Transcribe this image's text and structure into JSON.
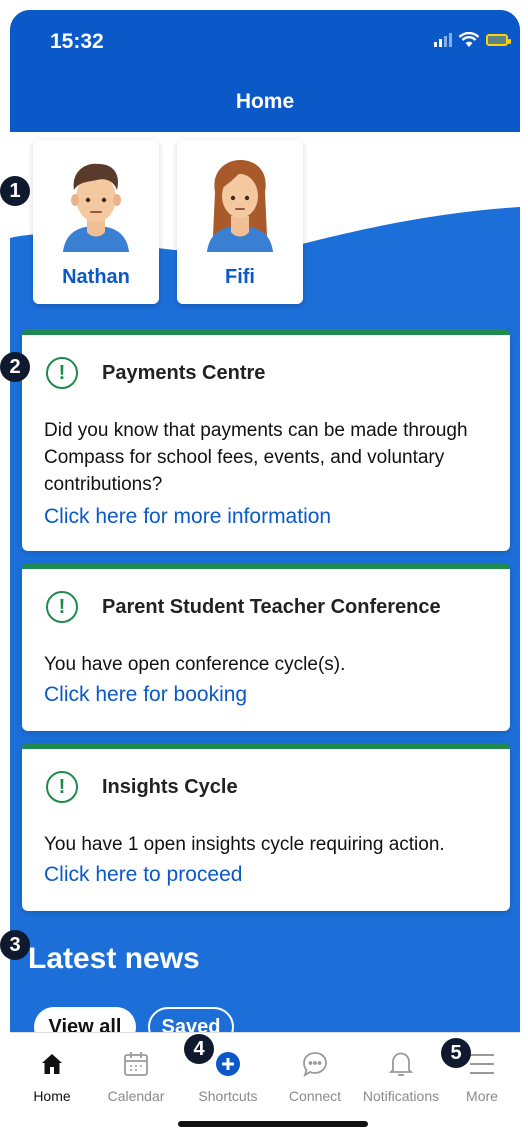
{
  "status_bar": {
    "time": "15:32"
  },
  "header": {
    "title": "Home"
  },
  "students": [
    {
      "name": "Nathan"
    },
    {
      "name": "Fifi"
    }
  ],
  "cards": [
    {
      "title": "Payments Centre",
      "body": "Did you know that payments can be made through Compass for school fees, events, and voluntary contributions?",
      "link": "Click here for more information"
    },
    {
      "title": "Parent Student Teacher Conference",
      "body": "You have open conference cycle(s).",
      "link": "Click here for booking"
    },
    {
      "title": "Insights Cycle",
      "body": "You have 1 open insights cycle requiring action.",
      "link": "Click here to proceed"
    }
  ],
  "news": {
    "title": "Latest news",
    "filters": [
      "View all",
      "Saved"
    ]
  },
  "tabbar": {
    "items": [
      {
        "label": "Home",
        "icon": "home-icon"
      },
      {
        "label": "Calendar",
        "icon": "calendar-icon"
      },
      {
        "label": "Shortcuts",
        "icon": "plus-circle-icon"
      },
      {
        "label": "Connect",
        "icon": "chat-bubble-icon"
      },
      {
        "label": "Notifications",
        "icon": "bell-icon"
      },
      {
        "label": "More",
        "icon": "hamburger-menu-icon"
      }
    ]
  },
  "annotations": [
    "1",
    "2",
    "3",
    "4",
    "5"
  ],
  "colors": {
    "brand_blue": "#0b59c9",
    "accent_green": "#1e8a4d"
  }
}
